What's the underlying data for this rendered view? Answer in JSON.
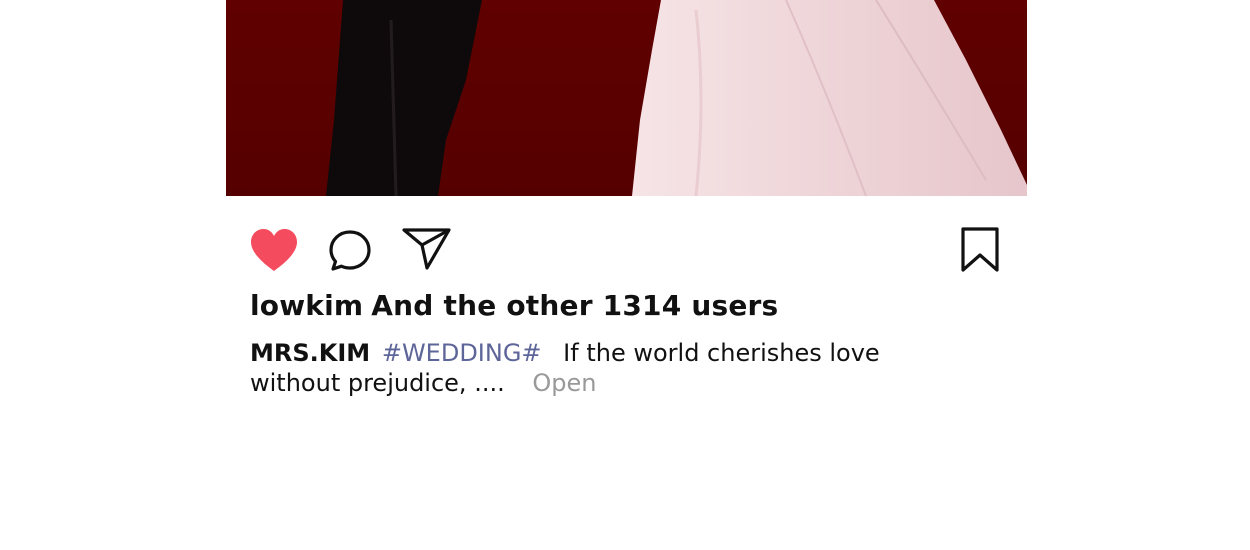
{
  "post": {
    "photo": {
      "description_colors": {
        "background": "#5a0000",
        "dress": "#f3dcdf",
        "suit": "#0e0a0b"
      }
    },
    "actions": {
      "like_icon": "heart-icon",
      "like_active": true,
      "like_color": "#f54b5e",
      "comment_icon": "comment-icon",
      "share_icon": "paper-plane-icon",
      "save_icon": "bookmark-icon"
    },
    "likes": {
      "user": "lowkim",
      "rest": "And the other 1314 users"
    },
    "caption": {
      "user": "MRS.KIM",
      "hashtag": "#WEDDING#",
      "text": "If the world cherishes love without prejudice, ....",
      "more_label": "Open"
    }
  }
}
